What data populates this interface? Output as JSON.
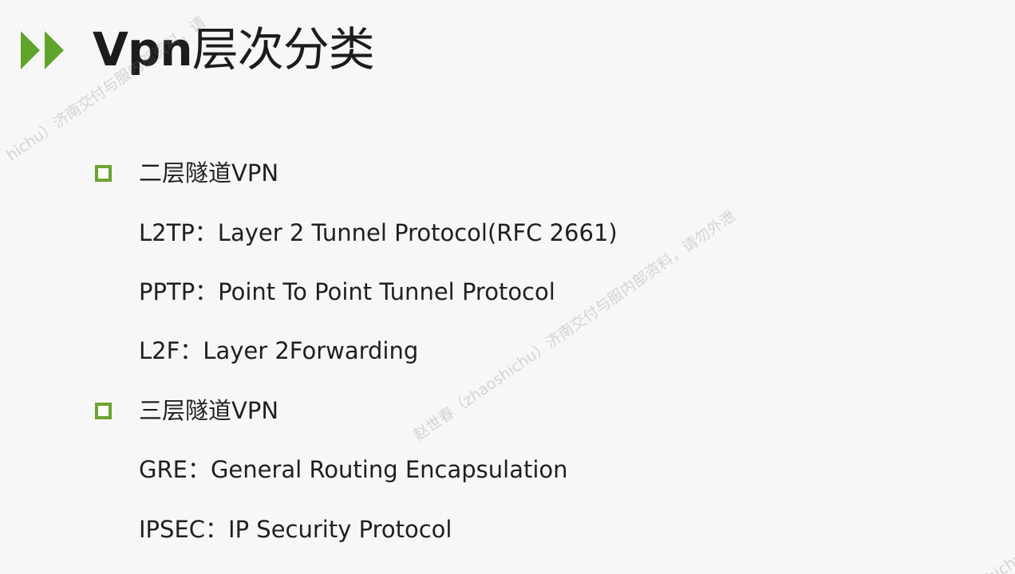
{
  "title": {
    "prefix": "Vpn",
    "rest": "层次分类"
  },
  "sections": [
    {
      "heading": "二层隧道VPN",
      "items": [
        "L2TP：Layer 2 Tunnel Protocol(RFC 2661)",
        "PPTP：Point To Point Tunnel Protocol",
        "L2F：Layer 2Forwarding"
      ]
    },
    {
      "heading": "三层隧道VPN",
      "items": [
        "GRE：General Routing Encapsulation",
        "IPSEC：IP Security Protocol"
      ]
    }
  ],
  "watermarks": [
    "hichu）济南交付与服内部资料，请",
    "赵世春（zhaoshichu）济南交付与服内部资料，请勿外泄",
    "hichu"
  ],
  "colors": {
    "accent": "#6aa531",
    "text": "#1f1f1f",
    "background": "#f7f7f7"
  }
}
